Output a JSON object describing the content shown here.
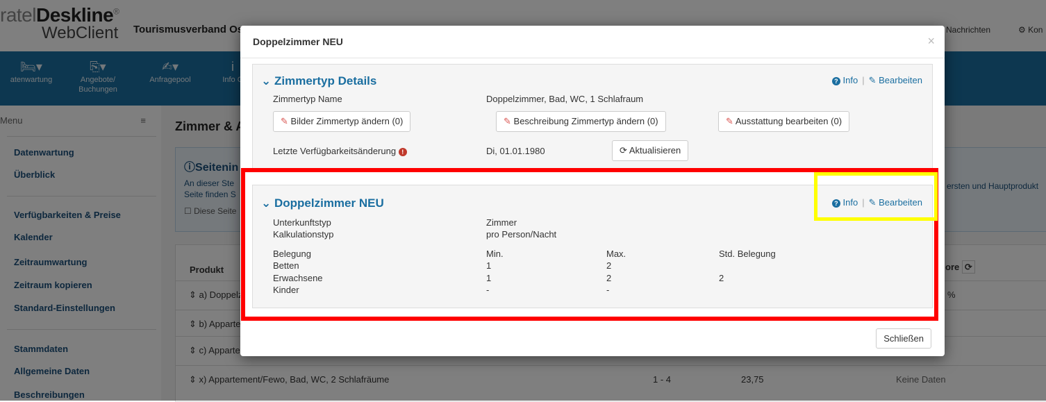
{
  "app": {
    "logo_part1": "ratel",
    "logo_part2": "Deskline",
    "logo_reg": "®",
    "logo_sub": "WebClient",
    "org": "Tourismusverband Os",
    "top_links": [
      "Nachrichten",
      "Kon"
    ]
  },
  "nav": [
    {
      "label": "atenwartung",
      "icon": "bed-icon"
    },
    {
      "label": "Angebote/ Buchungen",
      "icon": "offers-icon"
    },
    {
      "label": "Anfragepool",
      "icon": "request-icon"
    },
    {
      "label": "Info C",
      "icon": "info-icon"
    }
  ],
  "sidebar": {
    "menu_label": "Menu",
    "group1": [
      "Datenwartung",
      "Überblick"
    ],
    "group2": [
      "Verfügbarkeiten & Preise",
      "Kalender",
      "Zeitraumwartung",
      "Zeitraum kopieren",
      "Standard-Einstellungen"
    ],
    "group3": [
      "Stammdaten",
      "Allgemeine Daten",
      "Beschreibungen"
    ]
  },
  "content": {
    "page_title": "Zimmer & A",
    "info_title": "Seitenin",
    "info_text1": "An dieser Ste",
    "info_text2": "Seite finden S",
    "info_check": "Diese Seite",
    "info_right": "ersten und Hauptprodukt",
    "table_header_produkt": "Produkt",
    "table_header_right": "ore",
    "rows": [
      {
        "name": "a) Doppelz",
        "right": "%"
      },
      {
        "name": "b) Apparte",
        "right": ""
      },
      {
        "name": "c) Apparte",
        "right": ""
      },
      {
        "name": "x) Appartement/Fewo, Bad, WC, 2 Schlafräume",
        "pers": "1 - 4",
        "price": "23,75",
        "right": "Keine Daten"
      }
    ]
  },
  "modal": {
    "title": "Doppelzimmer NEU",
    "close_icon": "×",
    "panel1": {
      "title": "Zimmertyp Details",
      "info": "Info",
      "edit": "Bearbeiten",
      "name_label": "Zimmertyp Name",
      "name_value": "Doppelzimmer, Bad, WC, 1 Schlafraum",
      "btn_images": "Bilder Zimmertyp ändern (0)",
      "btn_desc": "Beschreibung Zimmertyp ändern (0)",
      "btn_equip": "Ausstattung bearbeiten (0)",
      "avail_label": "Letzte Verfügbarkeitsänderung",
      "avail_value": "Di, 01.01.1980",
      "btn_refresh": "Aktualisieren"
    },
    "panel2": {
      "title": "Doppelzimmer NEU",
      "info": "Info",
      "edit": "Bearbeiten",
      "type_label": "Unterkunftstyp",
      "type_value": "Zimmer",
      "calc_label": "Kalkulationstyp",
      "calc_value": "pro Person/Nacht",
      "occupancy": {
        "headers": [
          "Belegung",
          "Min.",
          "Max.",
          "Std. Belegung"
        ],
        "rows": [
          [
            "Betten",
            "1",
            "2",
            ""
          ],
          [
            "Erwachsene",
            "1",
            "2",
            "2"
          ],
          [
            "Kinder",
            "-",
            "-",
            ""
          ]
        ]
      }
    },
    "close_button": "Schließen"
  }
}
